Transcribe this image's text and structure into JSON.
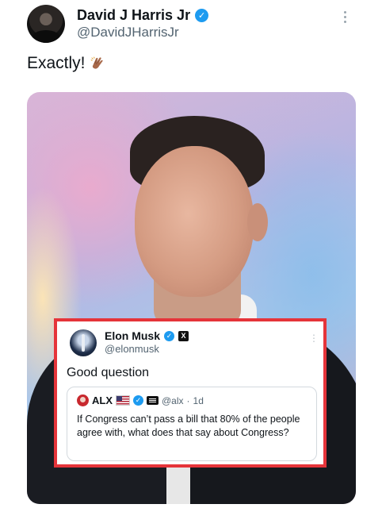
{
  "author": {
    "name": "David J Harris Jr",
    "handle": "@DavidJHarrisJr",
    "verified_icon": "verified-badge-icon",
    "avatar_icon": "profile-photo"
  },
  "tweet": {
    "text": "Exactly!",
    "emoji_icon": "clapping-hands-emoji-icon"
  },
  "media": {
    "type": "photo",
    "subject_icon": "man-in-suit-photo"
  },
  "quoted_tweet": {
    "name": "Elon Musk",
    "handle": "@elonmusk",
    "badges": [
      "verified-badge-icon",
      "x-logo-icon"
    ],
    "text": "Good question",
    "highlight_color": "#e5343a",
    "nested_quote": {
      "name": "ALX",
      "badges": [
        "us-flag-icon",
        "verified-badge-icon",
        "newspaper-icon"
      ],
      "handle": "@alx",
      "separator": "·",
      "time": "1d",
      "text": "If Congress can’t pass a bill that 80% of the people agree with, what does that say about Congress?"
    }
  },
  "colors": {
    "accent": "#1d9bf0",
    "secondary_text": "#536471",
    "highlight_border": "#e5343a"
  }
}
